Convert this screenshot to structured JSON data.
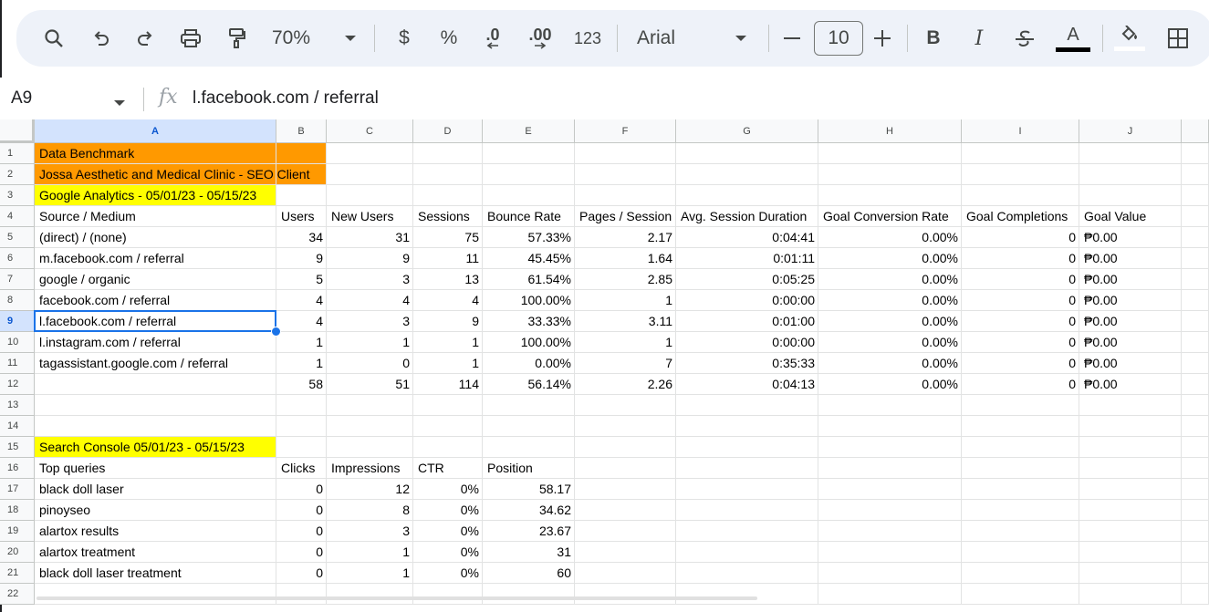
{
  "toolbar": {
    "zoom": "70%",
    "currency": "$",
    "percent": "%",
    "dec_decrease": ".0",
    "dec_increase": ".00",
    "number_format": "123",
    "font": "Arial",
    "font_size": "10",
    "bold": "B",
    "italic": "I",
    "text_color_letter": "A"
  },
  "formula_bar": {
    "cell_ref": "A9",
    "fx": "fx",
    "content": "l.facebook.com / referral"
  },
  "columns": [
    "A",
    "B",
    "C",
    "D",
    "E",
    "F",
    "G",
    "H",
    "I",
    "J"
  ],
  "rows": [
    "1",
    "2",
    "3",
    "4",
    "5",
    "6",
    "7",
    "8",
    "9",
    "10",
    "11",
    "12",
    "13",
    "14",
    "15",
    "16",
    "17",
    "18",
    "19",
    "20",
    "21",
    "22"
  ],
  "active": {
    "column": "A",
    "row": "9"
  },
  "colors": {
    "orange_fill": "#ff9900",
    "yellow_fill": "#ffff00",
    "selection": "#1a73e8"
  },
  "sheet": {
    "r1": [
      "Data Benchmark"
    ],
    "r2": [
      "Jossa Aesthetic and Medical Clinic - SEO Client"
    ],
    "r3": [
      "Google Analytics - 05/01/23 - 05/15/23"
    ],
    "r4": [
      "Source / Medium",
      "Users",
      "New Users",
      "Sessions",
      "Bounce Rate",
      "Pages / Session",
      "Avg. Session Duration",
      "Goal Conversion Rate",
      "Goal Completions",
      "Goal Value"
    ],
    "r5": [
      "(direct) / (none)",
      "34",
      "31",
      "75",
      "57.33%",
      "2.17",
      "0:04:41",
      "0.00%",
      "0",
      "₱0.00"
    ],
    "r6": [
      "m.facebook.com / referral",
      "9",
      "9",
      "11",
      "45.45%",
      "1.64",
      "0:01:11",
      "0.00%",
      "0",
      "₱0.00"
    ],
    "r7": [
      "google / organic",
      "5",
      "3",
      "13",
      "61.54%",
      "2.85",
      "0:05:25",
      "0.00%",
      "0",
      "₱0.00"
    ],
    "r8": [
      "facebook.com / referral",
      "4",
      "4",
      "4",
      "100.00%",
      "1",
      "0:00:00",
      "0.00%",
      "0",
      "₱0.00"
    ],
    "r9": [
      "l.facebook.com / referral",
      "4",
      "3",
      "9",
      "33.33%",
      "3.11",
      "0:01:00",
      "0.00%",
      "0",
      "₱0.00"
    ],
    "r10": [
      "l.instagram.com / referral",
      "1",
      "1",
      "1",
      "100.00%",
      "1",
      "0:00:00",
      "0.00%",
      "0",
      "₱0.00"
    ],
    "r11": [
      "tagassistant.google.com / referral",
      "1",
      "0",
      "1",
      "0.00%",
      "7",
      "0:35:33",
      "0.00%",
      "0",
      "₱0.00"
    ],
    "r12": [
      "",
      "58",
      "51",
      "114",
      "56.14%",
      "2.26",
      "0:04:13",
      "0.00%",
      "0",
      "₱0.00"
    ],
    "r15": [
      "Search Console 05/01/23 - 05/15/23"
    ],
    "r16": [
      "Top queries",
      "Clicks",
      "Impressions",
      "CTR",
      "Position"
    ],
    "r17": [
      "black doll laser",
      "0",
      "12",
      "0%",
      "58.17"
    ],
    "r18": [
      "pinoyseo",
      "0",
      "8",
      "0%",
      "34.62"
    ],
    "r19": [
      "alartox results",
      "0",
      "3",
      "0%",
      "23.67"
    ],
    "r20": [
      "alartox treatment",
      "0",
      "1",
      "0%",
      "31"
    ],
    "r21": [
      "black doll laser treatment",
      "0",
      "1",
      "0%",
      "60"
    ]
  }
}
